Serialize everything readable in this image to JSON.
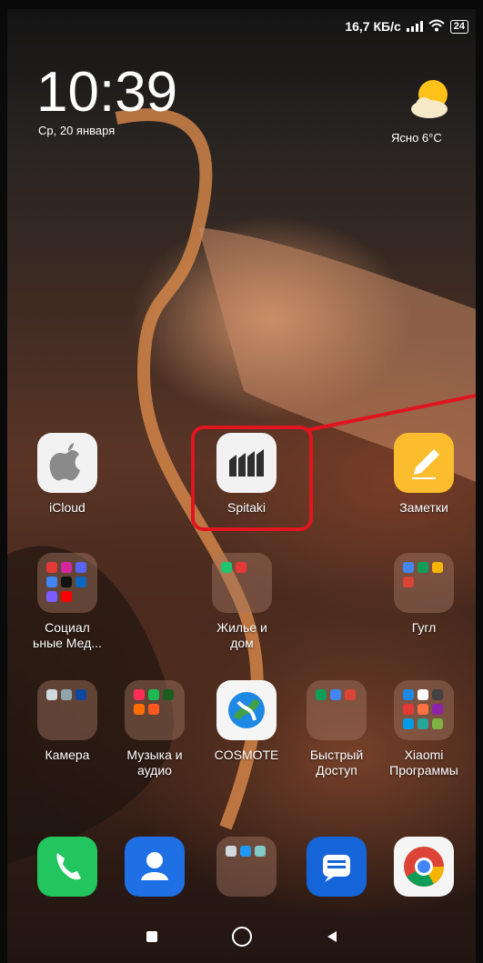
{
  "status_bar": {
    "speed": "16,7 КБ/с",
    "battery": "24"
  },
  "lock": {
    "time": "10:39",
    "date": "Ср, 20 января"
  },
  "weather": {
    "text": "Ясно  6°C",
    "icon": "partly-sunny-icon"
  },
  "apps": {
    "icloud": "iCloud",
    "spitaki": "Spitaki",
    "zametki": "Заметки",
    "social_line1": "Социал",
    "social_line2": "ьные Мед...",
    "housing_line1": "Жилье и",
    "housing_line2": "дом",
    "google": "Гугл",
    "camera": "Камера",
    "music_line1": "Музыка и",
    "music_line2": "аудио",
    "cosmote": "COSMOTE",
    "quick_line1": "Быстрый",
    "quick_line2": "Доступ",
    "xiaomi_line1": "Xiaomi",
    "xiaomi_line2": "Программы"
  },
  "dock": [
    "phone-icon",
    "contacts-icon",
    "folder-icon",
    "messages-icon",
    "chrome-icon"
  ],
  "nav": [
    "recents-button",
    "home-button",
    "back-button"
  ],
  "colors": {
    "highlight": "#e0151f",
    "phone": "#22c55e",
    "contacts": "#1f6fe5",
    "messages": "#1565d8"
  }
}
